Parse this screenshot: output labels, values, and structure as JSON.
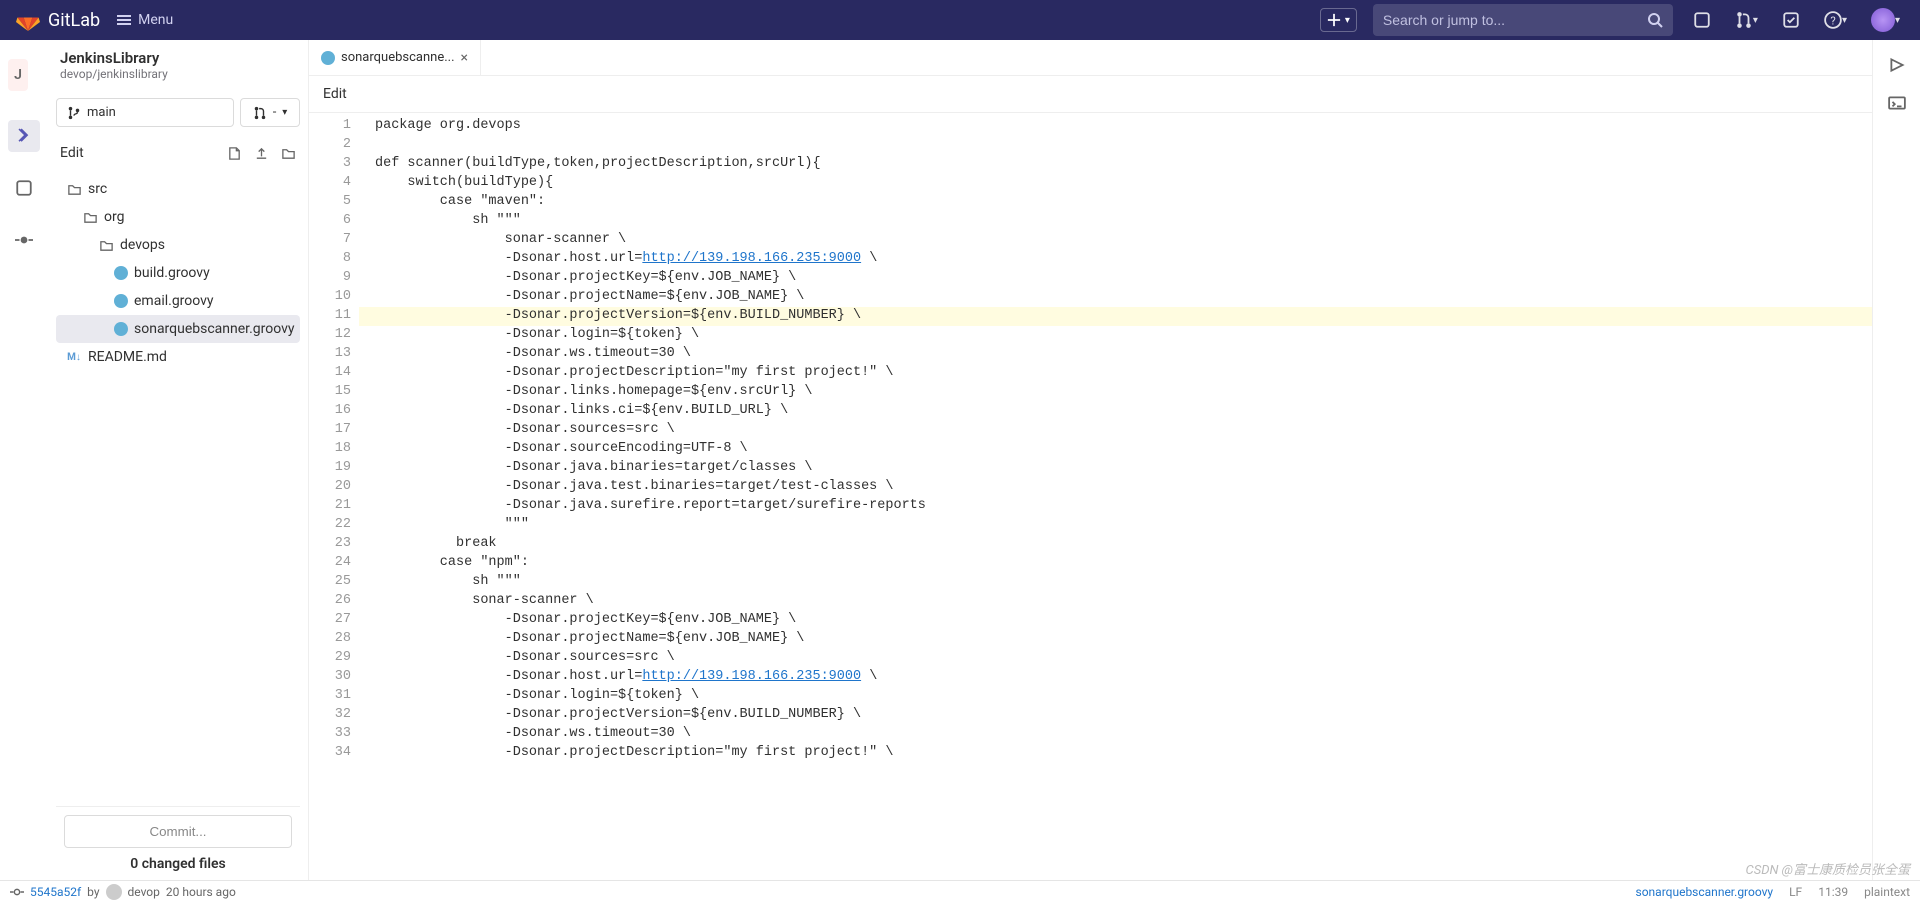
{
  "header": {
    "brand": "GitLab",
    "menu_label": "Menu",
    "search_placeholder": "Search or jump to..."
  },
  "project": {
    "avatar_letter": "J",
    "name": "JenkinsLibrary",
    "path": "devop/jenkinslibrary"
  },
  "branch": {
    "name": "main",
    "mr_label": "-"
  },
  "sidebar": {
    "edit_label": "Edit",
    "tree": [
      {
        "type": "folder",
        "name": "src",
        "indent": 0
      },
      {
        "type": "folder",
        "name": "org",
        "indent": 1
      },
      {
        "type": "folder",
        "name": "devops",
        "indent": 2
      },
      {
        "type": "groovy",
        "name": "build.groovy",
        "indent": 3
      },
      {
        "type": "groovy",
        "name": "email.groovy",
        "indent": 3
      },
      {
        "type": "groovy",
        "name": "sonarquebscanner.groovy",
        "indent": 3,
        "active": true
      },
      {
        "type": "md",
        "name": "README.md",
        "indent": 0
      }
    ],
    "commit_button": "Commit...",
    "changed_files": "0 changed files"
  },
  "tabs": {
    "active_tab": "sonarquebscanne...",
    "secondary_label": "Edit"
  },
  "code_lines": [
    "package org.devops",
    "",
    "def scanner(buildType,token,projectDescription,srcUrl){",
    "    switch(buildType){",
    "        case \"maven\":",
    "            sh \"\"\"",
    "                sonar-scanner \\",
    "                -Dsonar.host.url=http://139.198.166.235:9000 \\",
    "                -Dsonar.projectKey=${env.JOB_NAME} \\",
    "                -Dsonar.projectName=${env.JOB_NAME} \\",
    "                -Dsonar.projectVersion=${env.BUILD_NUMBER} \\",
    "                -Dsonar.login=${token} \\",
    "                -Dsonar.ws.timeout=30 \\",
    "                -Dsonar.projectDescription=\"my first project!\" \\",
    "                -Dsonar.links.homepage=${env.srcUrl} \\",
    "                -Dsonar.links.ci=${env.BUILD_URL} \\",
    "                -Dsonar.sources=src \\",
    "                -Dsonar.sourceEncoding=UTF-8 \\",
    "                -Dsonar.java.binaries=target/classes \\",
    "                -Dsonar.java.test.binaries=target/test-classes \\",
    "                -Dsonar.java.surefire.report=target/surefire-reports",
    "                \"\"\"",
    "          break",
    "        case \"npm\":",
    "            sh \"\"\"",
    "            sonar-scanner \\",
    "                -Dsonar.projectKey=${env.JOB_NAME} \\",
    "                -Dsonar.projectName=${env.JOB_NAME} \\",
    "                -Dsonar.sources=src \\",
    "                -Dsonar.host.url=http://139.198.166.235:9000 \\",
    "                -Dsonar.login=${token} \\",
    "                -Dsonar.projectVersion=${env.BUILD_NUMBER} \\",
    "                -Dsonar.ws.timeout=30 \\",
    "                -Dsonar.projectDescription=\"my first project!\" \\"
  ],
  "highlight_line": 11,
  "url_lines": [
    8,
    30
  ],
  "url_text": "http://139.198.166.235:9000",
  "footer": {
    "commit_sha": "5545a52f",
    "by_label": "by",
    "author": "devop",
    "time": "20 hours ago",
    "file": "sonarquebscanner.groovy",
    "line_ending": "LF",
    "position": "11:39",
    "mode": "plaintext"
  },
  "watermark": "CSDN @富士康质检员张全蛋"
}
